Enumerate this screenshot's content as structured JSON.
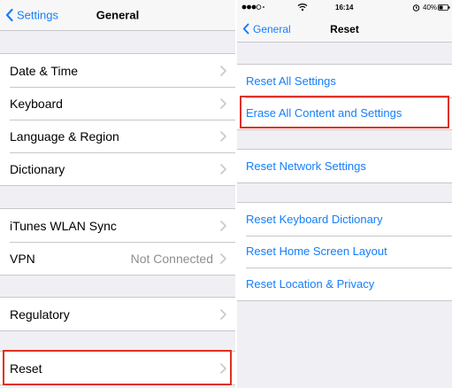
{
  "left": {
    "back_label": "Settings",
    "title": "General",
    "groups": [
      [
        "Date & Time",
        "Keyboard",
        "Language & Region",
        "Dictionary"
      ],
      [
        "iTunes WLAN Sync",
        "VPN"
      ],
      [
        "Regulatory"
      ],
      [
        "Reset"
      ]
    ],
    "vpn_status": "Not Connected"
  },
  "right": {
    "status": {
      "time": "16:14",
      "battery": "40%"
    },
    "back_label": "General",
    "title": "Reset",
    "groups": [
      [
        "Reset All Settings",
        "Erase All Content and Settings"
      ],
      [
        "Reset Network Settings"
      ],
      [
        "Reset Keyboard Dictionary",
        "Reset Home Screen Layout",
        "Reset Location & Privacy"
      ]
    ]
  },
  "colors": {
    "accent": "#157efb",
    "background": "#efeff4",
    "highlight": "#e0301e",
    "secondary_text": "#8e8e93"
  },
  "icons": [
    "chevron-left-icon",
    "chevron-right-icon",
    "wifi-icon",
    "signal-icon",
    "alarm-icon",
    "battery-icon"
  ]
}
